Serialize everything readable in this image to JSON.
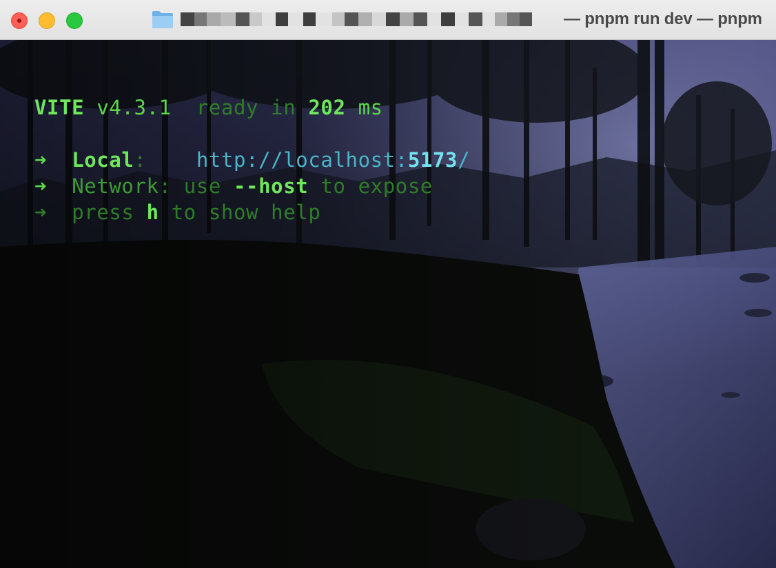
{
  "window": {
    "title_visible": "— pnpm run dev — pnpm",
    "folder_icon": "folder-icon"
  },
  "terminal": {
    "line1": {
      "tool": "VITE",
      "version": "v4.3.1",
      "ready": "ready in",
      "time_value": "202",
      "time_unit": "ms"
    },
    "local": {
      "arrow": "➜",
      "label": "Local",
      "colon": ":",
      "url_prefix": "http://localhost:",
      "port": "5173",
      "url_suffix": "/"
    },
    "network": {
      "arrow": "➜",
      "label": "Network",
      "colon": ":",
      "use": "use",
      "flag": "--host",
      "rest": "to expose"
    },
    "help": {
      "arrow": "➜",
      "press": "press",
      "key": "h",
      "rest": "to show help"
    }
  },
  "colors": {
    "vite_green": "#5bd94a",
    "dim_green": "#2f7d2a",
    "url_cyan": "#4ab5c9",
    "port_cyan": "#72e3ef"
  }
}
